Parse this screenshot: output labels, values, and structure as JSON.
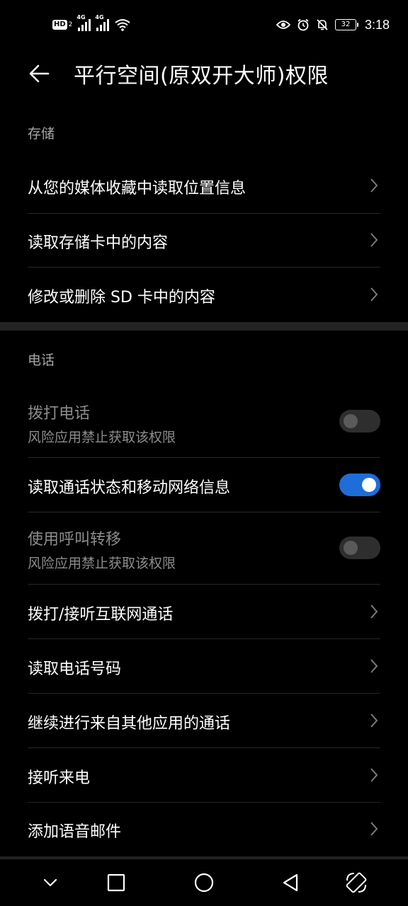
{
  "status_bar": {
    "hd_label": "HD",
    "hd_sub": "2",
    "sim1_tag": "4G",
    "sim2_tag": "4G",
    "battery": "32",
    "time": "3:18",
    "icons": [
      "eye-icon",
      "alarm-icon",
      "bell-off-icon",
      "wifi-icon"
    ]
  },
  "header": {
    "title": "平行空间(原双开大师)权限"
  },
  "sections": {
    "storage": {
      "label": "存储",
      "items": [
        {
          "title": "从您的媒体收藏中读取位置信息"
        },
        {
          "title": "读取存储卡中的内容"
        },
        {
          "title": "修改或删除 SD 卡中的内容"
        }
      ]
    },
    "phone": {
      "label": "电话",
      "items": [
        {
          "title": "拨打电话",
          "subtitle": "风险应用禁止获取该权限",
          "toggle": "off",
          "disabled": true
        },
        {
          "title": "读取通话状态和移动网络信息",
          "toggle": "on"
        },
        {
          "title": "使用呼叫转移",
          "subtitle": "风险应用禁止获取该权限",
          "toggle": "off",
          "disabled": true
        },
        {
          "title": "拨打/接听互联网通话"
        },
        {
          "title": "读取电话号码"
        },
        {
          "title": "继续进行来自其他应用的通话"
        },
        {
          "title": "接听来电"
        },
        {
          "title": "添加语音邮件"
        }
      ]
    }
  },
  "colors": {
    "background": "#000000",
    "accent": "#1f6dd8",
    "section_label": "#a6a6a6",
    "disabled_text": "#8c8c8c"
  }
}
